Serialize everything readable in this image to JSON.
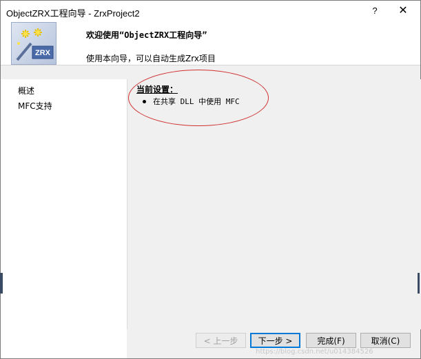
{
  "window": {
    "title": "ObjectZRX工程向导 - ZrxProject2",
    "help_label": "?",
    "close_label": "✕"
  },
  "header": {
    "title": "欢迎使用“ObjectZRX工程向导”",
    "subtitle": "使用本向导，可以自动生成Zrx项目",
    "logo_text": "ZRX"
  },
  "sidebar": {
    "items": [
      {
        "label": "概述"
      },
      {
        "label": "MFC支持"
      }
    ]
  },
  "main": {
    "heading": "当前设置：",
    "bullet": "在共享 DLL 中使用 MFC"
  },
  "footer": {
    "prev_label": "< 上一步",
    "next_label": "下一步 >",
    "finish_label": "完成(F)",
    "cancel_label": "取消(C)",
    "watermark": "https://blog.csdn.net/u014384526"
  },
  "colors": {
    "annotation_ellipse": "#d03030",
    "default_button_border": "#0078d7"
  }
}
